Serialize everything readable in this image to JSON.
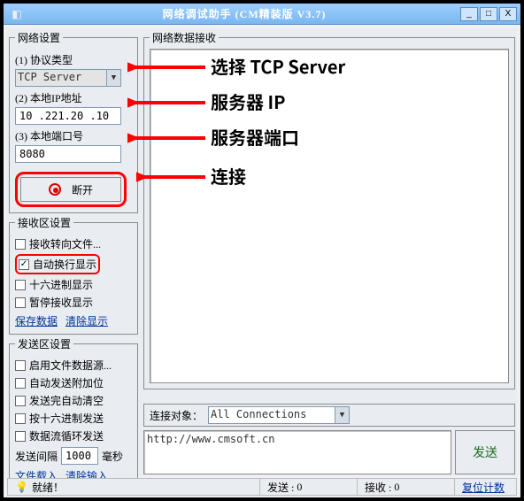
{
  "title": "网络调试助手 (CM精装版 V3.7)",
  "window_buttons": {
    "min": "_",
    "max": "□",
    "close": "X"
  },
  "left": {
    "net_settings_title": "网络设置",
    "proto_label": "(1) 协议类型",
    "proto_value": "TCP Server",
    "ip_label": "(2) 本地IP地址",
    "ip_value": "10 .221.20 .10",
    "port_label": "(3) 本地端口号",
    "port_value": "8080",
    "disconnect_label": "断开",
    "recv_settings_title": "接收区设置",
    "recv_opts": {
      "to_file": "接收转向文件...",
      "auto_wrap": "自动换行显示",
      "hex_view": "十六进制显示",
      "pause_view": "暂停接收显示"
    },
    "recv_links": {
      "save": "保存数据",
      "clear": "清除显示"
    },
    "send_settings_title": "发送区设置",
    "send_opts": {
      "file_src": "启用文件数据源...",
      "auto_append": "自动发送附加位",
      "auto_clear": "发送完自动清空",
      "hex_send": "按十六进制发送",
      "loop_send": "数据流循环发送"
    },
    "interval_label_a": "发送间隔",
    "interval_value": "1000",
    "interval_label_b": "毫秒",
    "send_links": {
      "load": "文件载入",
      "clear": "清除输入"
    }
  },
  "right": {
    "recv_title": "网络数据接收",
    "conn_label": "连接对象：",
    "conn_value": "All Connections",
    "send_text": "http://www.cmsoft.cn",
    "send_btn": "发送"
  },
  "status": {
    "ready": "就绪！",
    "tx_label": "发送 :",
    "tx_value": "0",
    "rx_label": "接收 :",
    "rx_value": "0",
    "reset": "复位计数"
  },
  "annotations": {
    "proto": "选择 TCP Server",
    "ip": "服务器 IP",
    "port": "服务器端口",
    "conn": "连接"
  }
}
